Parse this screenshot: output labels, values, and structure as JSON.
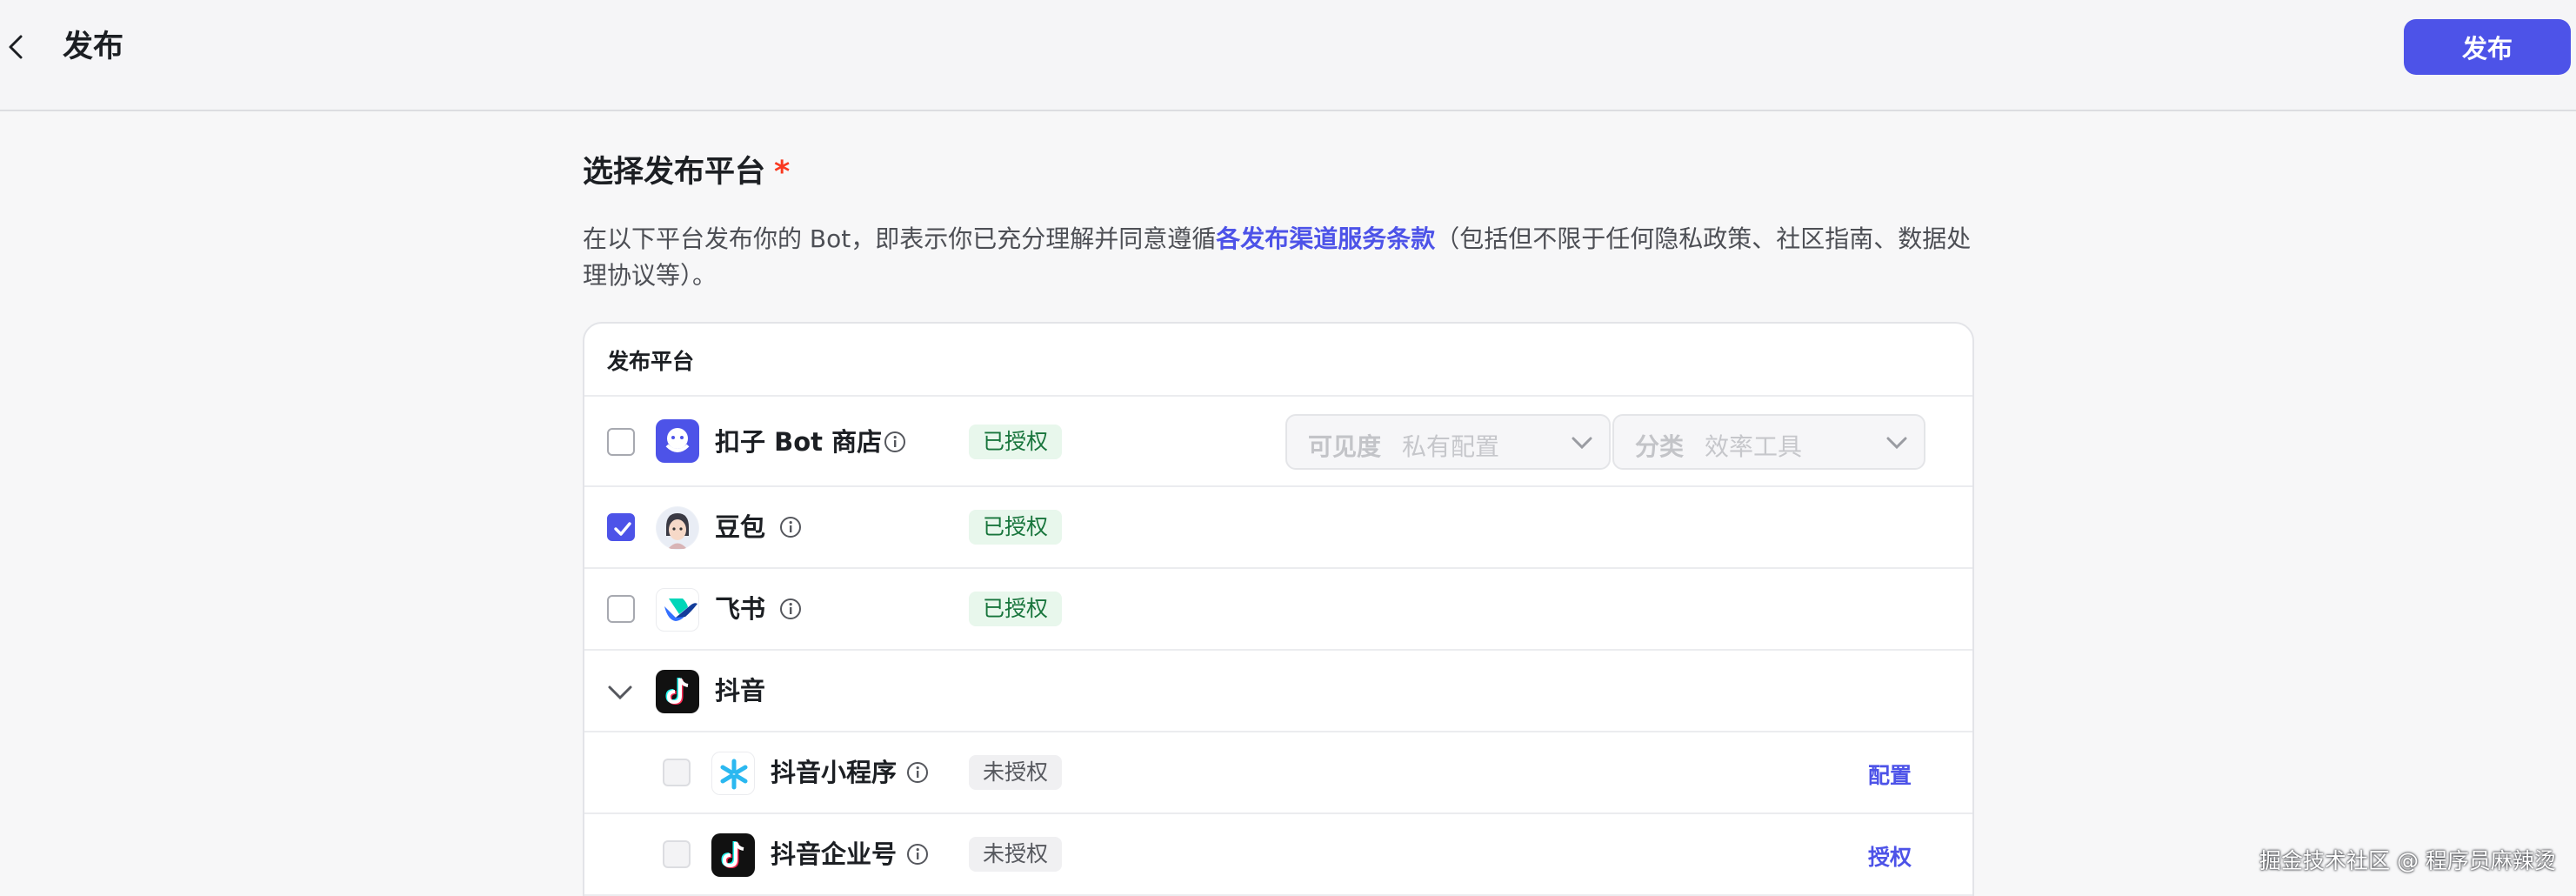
{
  "header": {
    "title": "发布",
    "publish_label": "发布"
  },
  "section": {
    "title": "选择发布平台",
    "required_mark": "*"
  },
  "description": {
    "before": "在以下平台发布你的 Bot，即表示你已充分理解并同意遵循",
    "link": "各发布渠道服务条款",
    "after": "（包括但不限于任何隐私政策、社区指南、数据处理协议等）。"
  },
  "table": {
    "header": "发布平台"
  },
  "platforms": {
    "coze": {
      "name": "扣子 Bot 商店",
      "status": "已授权",
      "checked": false,
      "visibility_label": "可见度",
      "visibility_value": "私有配置",
      "category_label": "分类",
      "category_value": "效率工具"
    },
    "doubao": {
      "name": "豆包",
      "status": "已授权",
      "checked": true
    },
    "feishu": {
      "name": "飞书",
      "status": "已授权",
      "checked": false
    },
    "douyin": {
      "name": "抖音",
      "children": [
        {
          "name": "抖音小程序",
          "status": "未授权",
          "action": "配置"
        },
        {
          "name": "抖音企业号",
          "status": "未授权",
          "action": "授权"
        }
      ]
    }
  },
  "watermark": "掘金技术社区 @ 程序员麻辣烫",
  "colors": {
    "accent": "#4d53e8",
    "authorized_bg": "#e8f7ec",
    "authorized_text": "#18753c",
    "required": "#f93920"
  }
}
